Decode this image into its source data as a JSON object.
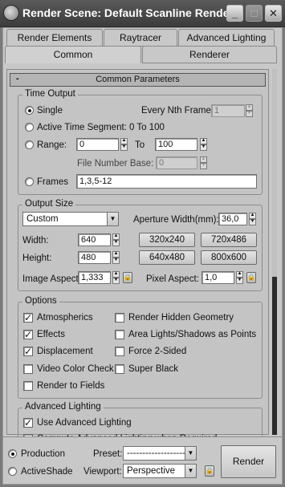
{
  "window": {
    "title": "Render Scene: Default Scanline Rende...",
    "minimize_glyph": "_",
    "maximize_glyph": "□",
    "close_glyph": "✕"
  },
  "tabs_row1": [
    "Render Elements",
    "Raytracer",
    "Advanced Lighting"
  ],
  "tabs_row2": [
    "Common",
    "Renderer"
  ],
  "active_tab": "Common",
  "rollout": {
    "collapse_glyph": "-",
    "title": "Common Parameters"
  },
  "time_output": {
    "title": "Time Output",
    "single_label": "Single",
    "every_nth_label": "Every Nth Frame:",
    "every_nth_value": "1",
    "active_segment_label": "Active Time Segment:",
    "active_segment_value": "0 To 100",
    "range_label": "Range:",
    "range_start": "0",
    "range_to_label": "To",
    "range_end": "100",
    "file_number_base_label": "File Number Base:",
    "file_number_base_value": "0",
    "frames_label": "Frames",
    "frames_value": "1,3,5-12",
    "selected": "Single"
  },
  "output_size": {
    "title": "Output Size",
    "preset_value": "Custom",
    "aperture_label": "Aperture Width(mm):",
    "aperture_value": "36,0",
    "width_label": "Width:",
    "width_value": "640",
    "height_label": "Height:",
    "height_value": "480",
    "presets": [
      "320x240",
      "720x486",
      "640x480",
      "800x600"
    ],
    "image_aspect_label": "Image Aspect:",
    "image_aspect_value": "1,333",
    "pixel_aspect_label": "Pixel Aspect:",
    "pixel_aspect_value": "1,0"
  },
  "options": {
    "title": "Options",
    "items": [
      {
        "label": "Atmospherics",
        "checked": true
      },
      {
        "label": "Render Hidden Geometry",
        "checked": false
      },
      {
        "label": "Effects",
        "checked": true
      },
      {
        "label": "Area Lights/Shadows as Points",
        "checked": false
      },
      {
        "label": "Displacement",
        "checked": true
      },
      {
        "label": "Force 2-Sided",
        "checked": false
      },
      {
        "label": "Video Color Check",
        "checked": false
      },
      {
        "label": "Super Black",
        "checked": false
      },
      {
        "label": "Render to Fields",
        "checked": false
      }
    ]
  },
  "advanced_lighting": {
    "title": "Advanced Lighting",
    "use_label": "Use Advanced Lighting",
    "use_checked": true,
    "compute_label": "Compute Advanced Lighting when Required"
  },
  "bottom": {
    "production_label": "Production",
    "activeshade_label": "ActiveShade",
    "preset_label": "Preset:",
    "preset_value": "--------------------",
    "viewport_label": "Viewport:",
    "viewport_value": "Perspective",
    "render_label": "Render"
  },
  "glyphs": {
    "check": "✓",
    "spin_up": "▲",
    "spin_down": "▼",
    "dropdown": "▼",
    "lock": "🔒"
  }
}
